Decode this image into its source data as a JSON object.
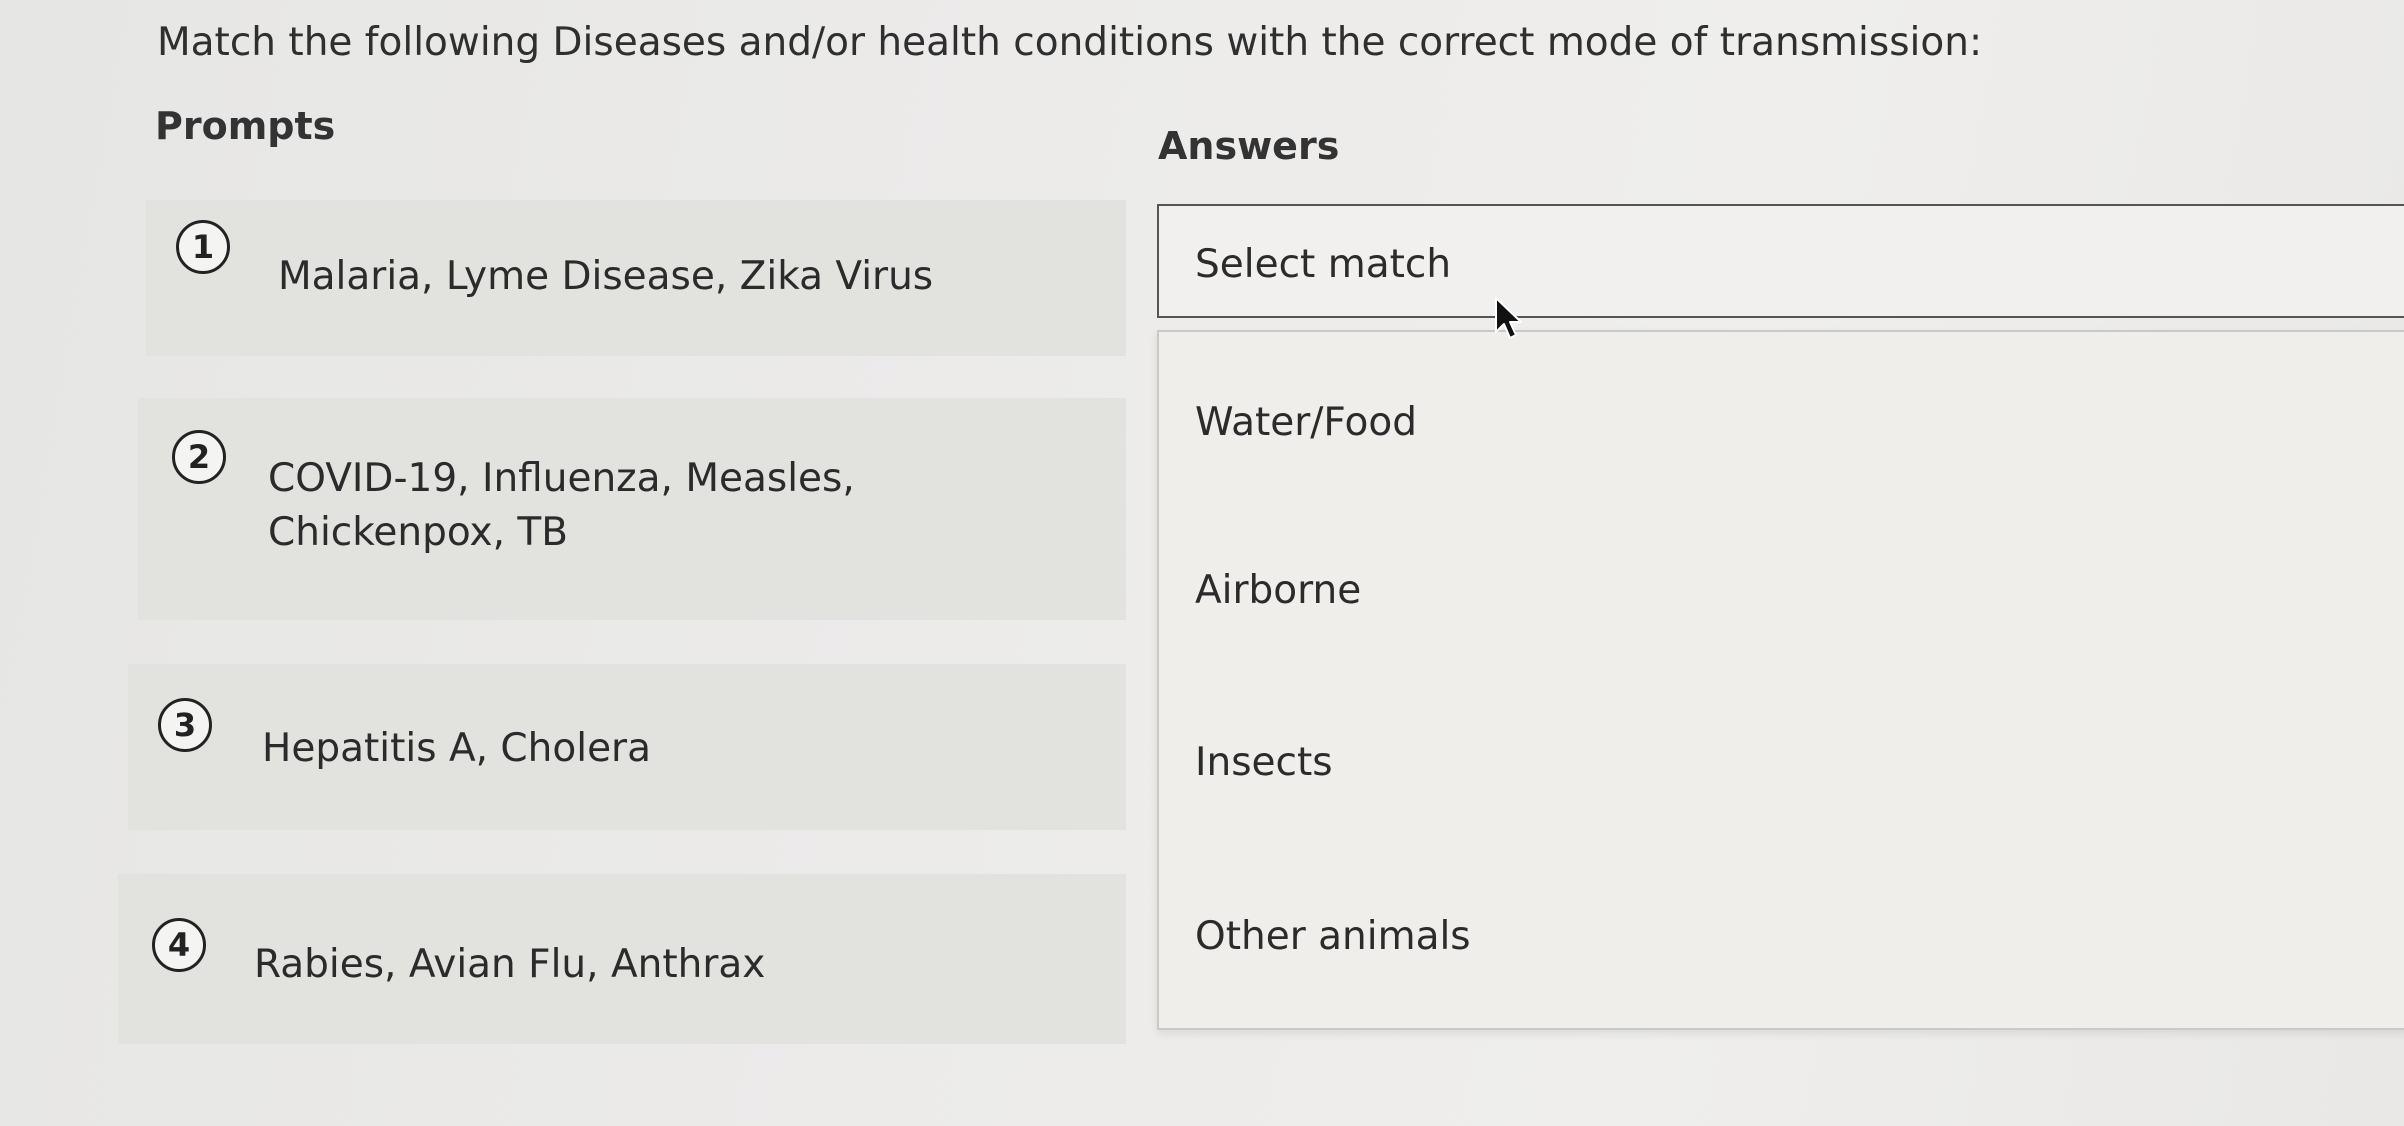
{
  "question": "Match the following Diseases and/or health conditions with the correct mode of transmission:",
  "prompts_header": "Prompts",
  "answers_header": "Answers",
  "prompts": [
    {
      "number": "1",
      "text": "Malaria, Lyme Disease, Zika Virus"
    },
    {
      "number": "2",
      "text": "COVID-19, Influenza, Measles, Chickenpox, TB"
    },
    {
      "number": "3",
      "text": "Hepatitis A, Cholera"
    },
    {
      "number": "4",
      "text": "Rabies, Avian Flu, Anthrax"
    }
  ],
  "select": {
    "label": "Select match"
  },
  "options": [
    "Water/Food",
    "Airborne",
    "Insects",
    "Other animals"
  ],
  "cursor_icon": "mouse-pointer-icon"
}
